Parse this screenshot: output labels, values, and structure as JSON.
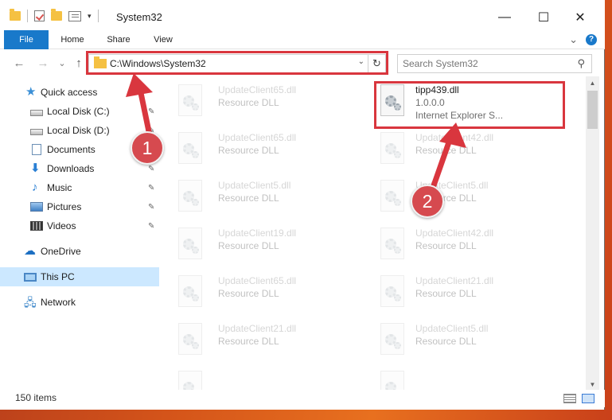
{
  "window": {
    "title": "System32"
  },
  "titlebar": {
    "minimize": "—",
    "maximize": "☐",
    "close": "✕"
  },
  "ribbon": {
    "tabs": [
      "File",
      "Home",
      "Share",
      "View"
    ],
    "expand_glyph": "⌄",
    "help_glyph": "?"
  },
  "nav": {
    "back_glyph": "←",
    "forward_glyph": "→",
    "recent_glyph": "⌄",
    "up_glyph": "↑",
    "address": "C:\\Windows\\System32",
    "address_dropdown_glyph": "⌄",
    "refresh_glyph": "↻",
    "search_placeholder": "Search System32",
    "search_glyph": "⚲"
  },
  "sidebar": {
    "items": [
      {
        "label": "Quick access",
        "icon": "star-icon",
        "pinned": false
      },
      {
        "label": "Local Disk (C:)",
        "icon": "disk-icon",
        "pinned": true
      },
      {
        "label": "Local Disk (D:)",
        "icon": "disk-icon",
        "pinned": true
      },
      {
        "label": "Documents",
        "icon": "documents-icon",
        "pinned": true
      },
      {
        "label": "Downloads",
        "icon": "downloads-icon",
        "pinned": true
      },
      {
        "label": "Music",
        "icon": "music-icon",
        "pinned": true
      },
      {
        "label": "Pictures",
        "icon": "pictures-icon",
        "pinned": true
      },
      {
        "label": "Videos",
        "icon": "videos-icon",
        "pinned": true
      },
      {
        "label": "OneDrive",
        "icon": "cloud-icon",
        "pinned": false
      },
      {
        "label": "This PC",
        "icon": "computer-icon",
        "pinned": false,
        "selected": true
      },
      {
        "label": "Network",
        "icon": "network-icon",
        "pinned": false
      }
    ],
    "pin_glyph": "📌"
  },
  "files": {
    "left_column": [
      {
        "name": "UpdateClient65.dll",
        "type": "Resource DLL"
      },
      {
        "name": "UpdateClient65.dll",
        "type": "Resource DLL"
      },
      {
        "name": "UpdateClient5.dll",
        "type": "Resource DLL"
      },
      {
        "name": "UpdateClient19.dll",
        "type": "Resource DLL"
      },
      {
        "name": "UpdateClient65.dll",
        "type": "Resource DLL"
      },
      {
        "name": "UpdateClient21.dll",
        "type": "Resource DLL"
      },
      {
        "name": "",
        "type": ""
      }
    ],
    "right_column": [
      {
        "name": "tipp439.dll",
        "version": "1.0.0.0",
        "type": "Internet Explorer S...",
        "highlighted": true
      },
      {
        "name": "UpdateClient42.dll",
        "type": "Resource DLL"
      },
      {
        "name": "UpdateClient5.dll",
        "type": "Resource DLL"
      },
      {
        "name": "UpdateClient42.dll",
        "type": "Resource DLL"
      },
      {
        "name": "UpdateClient21.dll",
        "type": "Resource DLL"
      },
      {
        "name": "UpdateClient5.dll",
        "type": "Resource DLL"
      },
      {
        "name": "",
        "type": ""
      }
    ]
  },
  "status": {
    "item_count": "150 items"
  },
  "annotations": {
    "callout_1": "1",
    "callout_2": "2",
    "color": "#d9363e"
  }
}
